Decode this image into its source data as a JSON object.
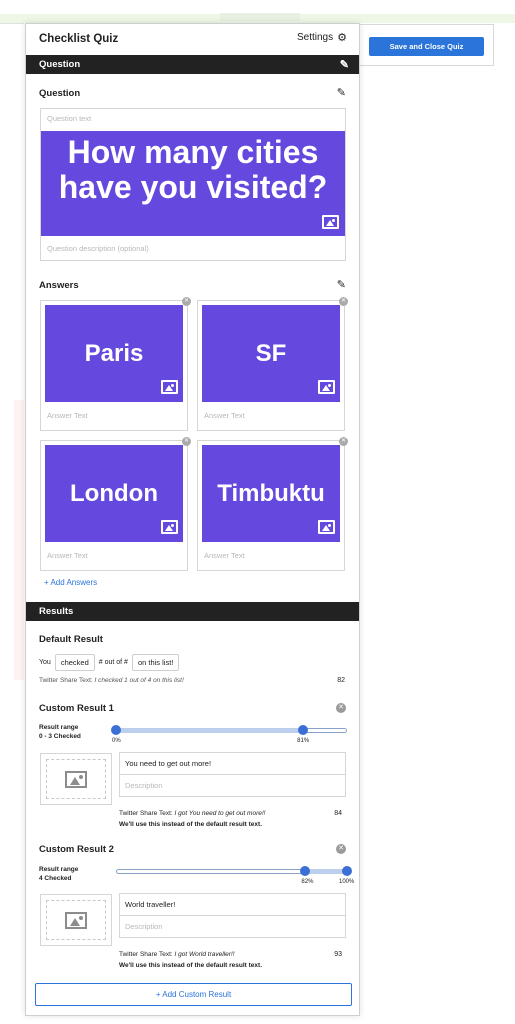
{
  "toolbar": {
    "save_close_label": "Save and Close Quiz"
  },
  "panel": {
    "title": "Checklist Quiz",
    "settings_label": "Settings"
  },
  "question_section": {
    "bar_label": "Question",
    "heading": "Question",
    "text_placeholder": "Question text",
    "image_text": "How many cities have you visited?",
    "description_placeholder": "Question description (optional)"
  },
  "answers": {
    "heading": "Answers",
    "items": [
      {
        "image_text": "Paris",
        "placeholder": "Answer Text"
      },
      {
        "image_text": "SF",
        "placeholder": "Answer Text"
      },
      {
        "image_text": "London",
        "placeholder": "Answer Text"
      },
      {
        "image_text": "Timbuktu",
        "placeholder": "Answer Text"
      }
    ],
    "add_label": "+ Add Answers"
  },
  "results": {
    "bar_label": "Results",
    "default": {
      "heading": "Default Result",
      "you": "You",
      "checked": "checked",
      "out_of": "# out of #",
      "on_list": "on this list!",
      "share_label": "Twitter Share Text:",
      "share_text": "I checked 1 out of 4 on this list!",
      "count": "82"
    },
    "custom": [
      {
        "heading": "Custom Result 1",
        "range_label": "Result range",
        "range_value": "0 - 3 Checked",
        "low_pct": "0%",
        "high_pct": "81%",
        "low": 0,
        "high": 0.81,
        "title": "You need to get out more!",
        "description_placeholder": "Description",
        "share_label": "Twitter Share Text:",
        "share_text": "I got You need to get out more!!",
        "count": "84",
        "note": "We'll use this instead of the default result text."
      },
      {
        "heading": "Custom Result 2",
        "range_label": "Result range",
        "range_value": "4 Checked",
        "low_pct": "82%",
        "high_pct": "100%",
        "low": 0.82,
        "high": 1.0,
        "title": "World traveller!",
        "description_placeholder": "Description",
        "share_label": "Twitter Share Text:",
        "share_text": "I got World traveller!!",
        "count": "93",
        "note": "We'll use this instead of the default result text."
      }
    ],
    "add_custom_label": "+ Add Custom Result"
  },
  "colors": {
    "accent": "#2b74d9",
    "image_bg": "#6548dd",
    "bar_bg": "#222222"
  }
}
